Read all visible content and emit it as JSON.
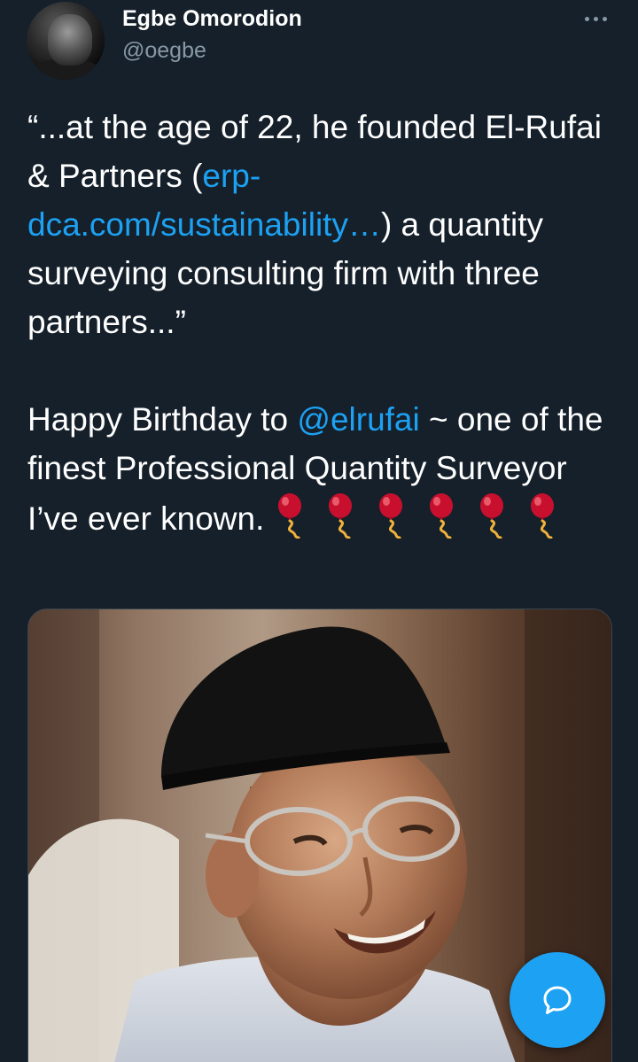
{
  "tweet": {
    "author_name": "Egbe Omorodion",
    "author_handle": "@oegbe",
    "more_icon": "more-horizontal-icon",
    "paragraph1": {
      "before_link": "“...at the age of 22, he founded El-Rufai & Partners (",
      "link_text": "erp-dca.com/sustainability…",
      "after_link": ") a quantity surveying consulting firm with three partners...”"
    },
    "paragraph2": {
      "before_mention": "Happy Birthday to ",
      "mention": "@elrufai",
      "after_mention": " ~ one of the finest Professional Quantity Surveyor I’ve ever known. "
    },
    "emoji_icon": "balloon-icon",
    "emoji_count": 6,
    "media_description_icon": "photo-image"
  },
  "fab": {
    "icon": "compose-message-icon"
  },
  "colors": {
    "background": "#15202b",
    "text": "#ffffff",
    "secondary_text": "#8899a6",
    "link": "#1da1f2",
    "fab": "#1da1f2",
    "balloon": "#c8102e"
  }
}
